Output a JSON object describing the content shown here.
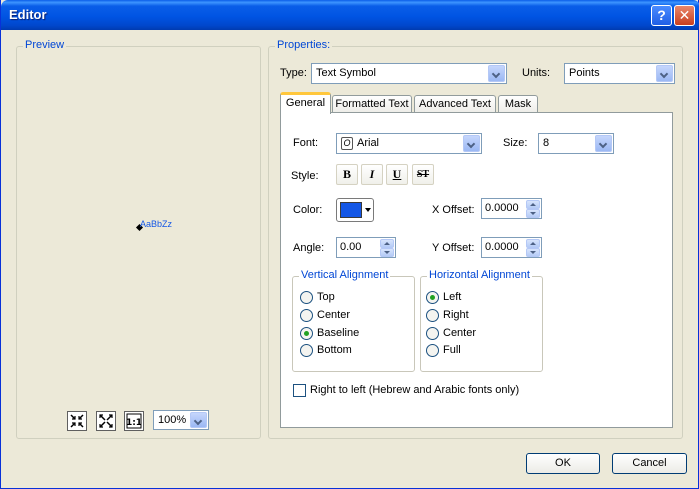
{
  "window": {
    "title": "Editor"
  },
  "title_buttons": {
    "help": "?",
    "close": "✕"
  },
  "preview": {
    "group_label": "Preview",
    "sample_text": "AaBbZz",
    "zoom_value": "100%",
    "tools": [
      "zoom-to-extent",
      "full-extent",
      "one-to-one"
    ]
  },
  "properties": {
    "group_label": "Properties:",
    "type_label": "Type:",
    "type_value": "Text Symbol",
    "units_label": "Units:",
    "units_value": "Points"
  },
  "tabs": [
    {
      "label": "General",
      "active": true
    },
    {
      "label": "Formatted Text",
      "active": false
    },
    {
      "label": "Advanced Text",
      "active": false
    },
    {
      "label": "Mask",
      "active": false
    }
  ],
  "general": {
    "font_label": "Font:",
    "font_value": "Arial",
    "size_label": "Size:",
    "size_value": "8",
    "style_label": "Style:",
    "style_buttons": {
      "bold": "B",
      "italic": "I",
      "underline": "U",
      "strike": "ST"
    },
    "color_label": "Color:",
    "color_value": "#1457e6",
    "x_offset_label": "X Offset:",
    "x_offset_value": "0.0000",
    "angle_label": "Angle:",
    "angle_value": "0.00",
    "y_offset_label": "Y Offset:",
    "y_offset_value": "0.0000"
  },
  "vertical_alignment": {
    "label": "Vertical Alignment",
    "options": [
      "Top",
      "Center",
      "Baseline",
      "Bottom"
    ],
    "selected": "Baseline"
  },
  "horizontal_alignment": {
    "label": "Horizontal Alignment",
    "options": [
      "Left",
      "Right",
      "Center",
      "Full"
    ],
    "selected": "Left"
  },
  "rtl": {
    "label": "Right to left (Hebrew and Arabic fonts only)",
    "checked": false
  },
  "buttons": {
    "ok": "OK",
    "cancel": "Cancel"
  }
}
